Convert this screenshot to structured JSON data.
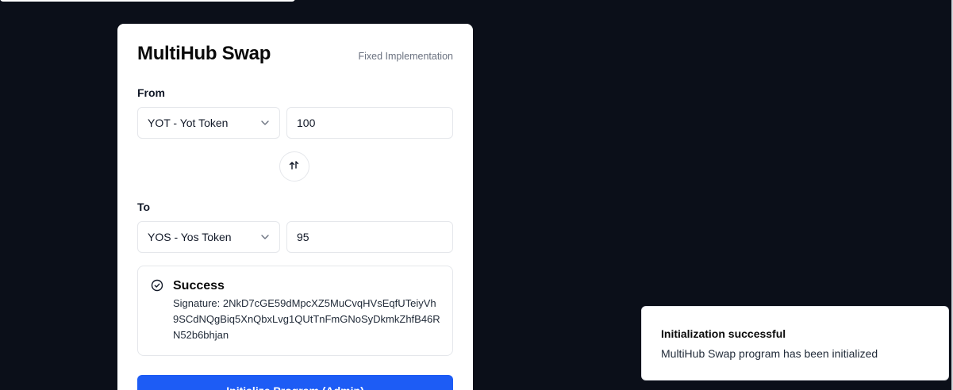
{
  "card": {
    "title": "MultiHub Swap",
    "subtitle": "Fixed Implementation"
  },
  "from": {
    "label": "From",
    "token": "YOT - Yot Token",
    "amount": "100"
  },
  "to": {
    "label": "To",
    "token": "YOS - Yos Token",
    "amount": "95"
  },
  "alert": {
    "title": "Success",
    "message": "Signature: 2NkD7cGE59dMpcXZ5MuCvqHVsEqfUTeiyVh9SCdNQgBiq5XnQbxLvg1QUtTnFmGNoSyDkmkZhfB46RN52b6bhjan"
  },
  "action": {
    "label": "Initialize Program (Admin)"
  },
  "toast": {
    "title": "Initialization successful",
    "description": "MultiHub Swap program has been initialized"
  },
  "icons": {
    "chevron": "chevron-down-icon",
    "swap": "swap-arrows-icon",
    "success": "check-circle-icon"
  },
  "colors": {
    "background": "#0b0f19",
    "accent": "#1d5cf5"
  }
}
